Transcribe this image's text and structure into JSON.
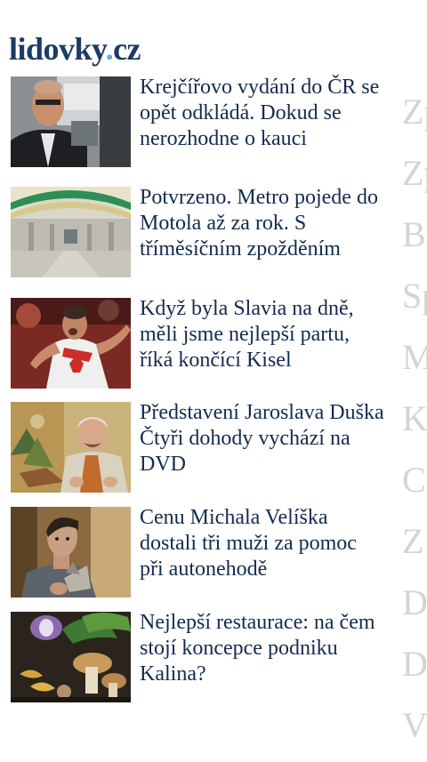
{
  "header": {
    "logo_main": "lidovky",
    "logo_dot": ".",
    "logo_tld": "cz"
  },
  "articles": [
    {
      "title": "Krejčířovo vydání do ČR se opět odkládá. Dokud se nerozhodne o kauci",
      "thumb": "man-portrait"
    },
    {
      "title": "Potvrzeno. Metro pojede do Motola až za rok. S tříměsíčním zpožděním",
      "thumb": "metro-station"
    },
    {
      "title": "Když byla Slavia na dně, měli jsme nejlepší partu, říká končící Kisel",
      "thumb": "football-player"
    },
    {
      "title": "Představení Jaroslava Duška Čtyři dohody vychází na DVD",
      "thumb": "actor-stage"
    },
    {
      "title": "Cenu Michala Velíška dostali tři muži za pomoc při autonehodě",
      "thumb": "award-man"
    },
    {
      "title": "Nejlepší restaurace: na čem stojí koncepce podniku Kalina?",
      "thumb": "food-mushrooms"
    }
  ],
  "side_panel": [
    "Zp",
    "Zp",
    "B",
    "Sp",
    "M",
    "K",
    "C",
    "Z",
    "D",
    "D",
    "V"
  ],
  "colors": {
    "logo": "#1c3a66",
    "logo_dot": "#6aa7d9",
    "headline": "#132b4f",
    "side_text": "#d4d4d4"
  }
}
